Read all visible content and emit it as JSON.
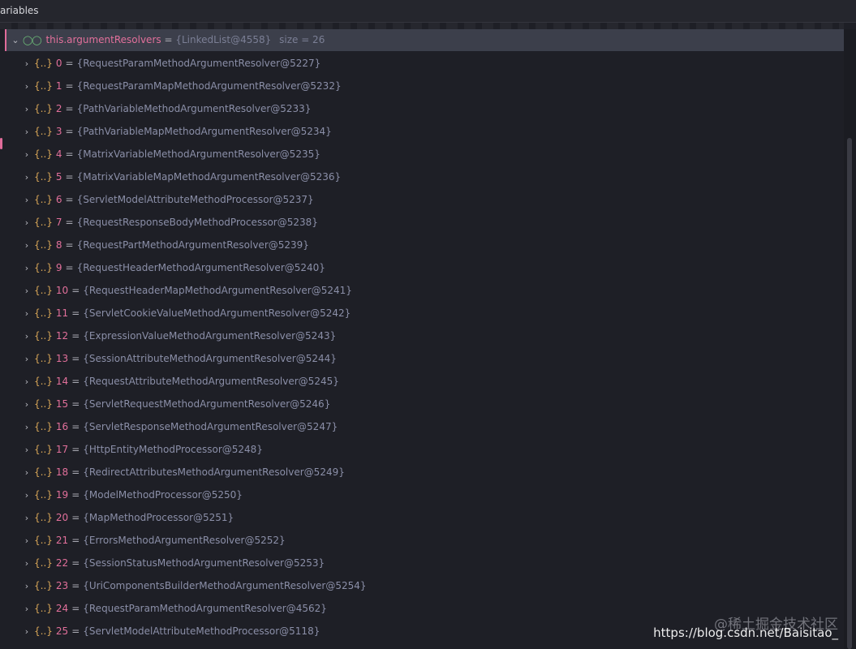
{
  "panel": {
    "title": "ariables"
  },
  "root": {
    "name": "this.argumentResolvers",
    "equals": "=",
    "type": "{LinkedList@4558}",
    "size": "size = 26",
    "watch_icon": "glasses-icon"
  },
  "items": [
    {
      "index": "0",
      "value": "{RequestParamMethodArgumentResolver@5227}"
    },
    {
      "index": "1",
      "value": "{RequestParamMapMethodArgumentResolver@5232}"
    },
    {
      "index": "2",
      "value": "{PathVariableMethodArgumentResolver@5233}"
    },
    {
      "index": "3",
      "value": "{PathVariableMapMethodArgumentResolver@5234}"
    },
    {
      "index": "4",
      "value": "{MatrixVariableMethodArgumentResolver@5235}"
    },
    {
      "index": "5",
      "value": "{MatrixVariableMapMethodArgumentResolver@5236}"
    },
    {
      "index": "6",
      "value": "{ServletModelAttributeMethodProcessor@5237}"
    },
    {
      "index": "7",
      "value": "{RequestResponseBodyMethodProcessor@5238}"
    },
    {
      "index": "8",
      "value": "{RequestPartMethodArgumentResolver@5239}"
    },
    {
      "index": "9",
      "value": "{RequestHeaderMethodArgumentResolver@5240}"
    },
    {
      "index": "10",
      "value": "{RequestHeaderMapMethodArgumentResolver@5241}"
    },
    {
      "index": "11",
      "value": "{ServletCookieValueMethodArgumentResolver@5242}"
    },
    {
      "index": "12",
      "value": "{ExpressionValueMethodArgumentResolver@5243}"
    },
    {
      "index": "13",
      "value": "{SessionAttributeMethodArgumentResolver@5244}"
    },
    {
      "index": "14",
      "value": "{RequestAttributeMethodArgumentResolver@5245}"
    },
    {
      "index": "15",
      "value": "{ServletRequestMethodArgumentResolver@5246}"
    },
    {
      "index": "16",
      "value": "{ServletResponseMethodArgumentResolver@5247}"
    },
    {
      "index": "17",
      "value": "{HttpEntityMethodProcessor@5248}"
    },
    {
      "index": "18",
      "value": "{RedirectAttributesMethodArgumentResolver@5249}"
    },
    {
      "index": "19",
      "value": "{ModelMethodProcessor@5250}"
    },
    {
      "index": "20",
      "value": "{MapMethodProcessor@5251}"
    },
    {
      "index": "21",
      "value": "{ErrorsMethodArgumentResolver@5252}"
    },
    {
      "index": "22",
      "value": "{SessionStatusMethodArgumentResolver@5253}"
    },
    {
      "index": "23",
      "value": "{UriComponentsBuilderMethodArgumentResolver@5254}"
    },
    {
      "index": "24",
      "value": "{RequestParamMethodArgumentResolver@4562}"
    },
    {
      "index": "25",
      "value": "{ServletModelAttributeMethodProcessor@5118}"
    }
  ],
  "item_brace": "{..}",
  "item_equals": "=",
  "watermark": {
    "line1": "@稀土掘金技术社区",
    "line2": "https://blog.csdn.net/Baisitao_"
  }
}
